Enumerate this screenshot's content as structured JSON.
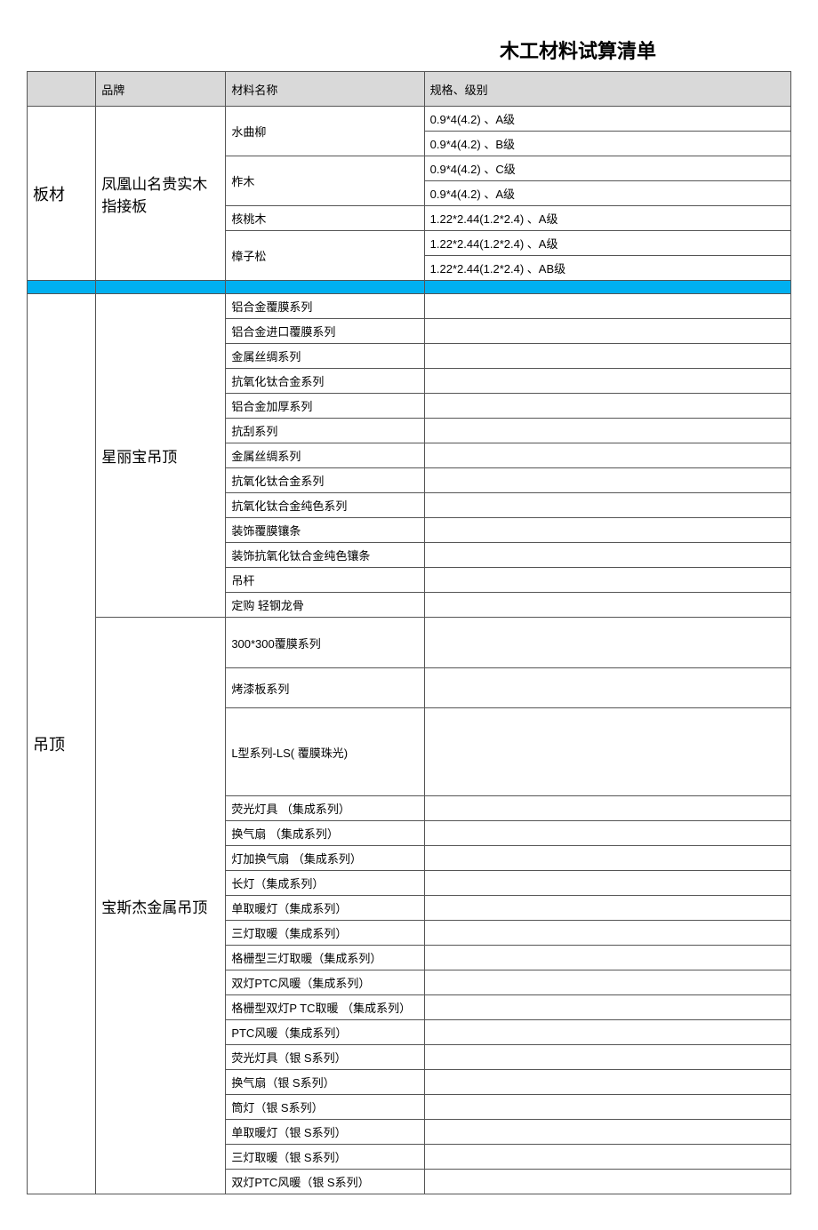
{
  "title": "木工材料试算清单",
  "headers": {
    "col1": "",
    "col2": "品牌",
    "col3": "材料名称",
    "col4": "规格、级别"
  },
  "section1": {
    "category": "板材",
    "brand": "凤凰山名贵实木指接板",
    "rows": [
      {
        "material": "水曲柳",
        "spec": "0.9*4(4.2)  、A级"
      },
      {
        "material": "",
        "spec": "0.9*4(4.2)  、B级"
      },
      {
        "material": "柞木",
        "spec": "0.9*4(4.2)  、C级"
      },
      {
        "material": "",
        "spec": "0.9*4(4.2)  、A级"
      },
      {
        "material": "核桃木",
        "spec": "1.22*2.44(1.2*2.4)   、A级"
      },
      {
        "material": "",
        "spec": "1.22*2.44(1.2*2.4)   、A级"
      },
      {
        "material": "樟子松",
        "spec": "1.22*2.44(1.2*2.4)   、AB级"
      }
    ]
  },
  "section2": {
    "category": "吊顶",
    "brand1": "星丽宝吊顶",
    "brand2": "宝斯杰金属吊顶",
    "rows1": [
      "铝合金覆膜系列",
      "铝合金进口覆膜系列",
      "金属丝绸系列",
      "抗氧化钛合金系列",
      "铝合金加厚系列",
      "抗刮系列",
      "金属丝绸系列",
      "抗氧化钛合金系列",
      "抗氧化钛合金纯色系列",
      "装饰覆膜镶条",
      "装饰抗氧化钛合金纯色镶条",
      "吊杆",
      "定购 轻钢龙骨"
    ],
    "rows2": [
      "300*300覆膜系列",
      "烤漆板系列",
      "L型系列-LS( 覆膜珠光)",
      "荧光灯具 （集成系列）",
      "换气扇 （集成系列）",
      "灯加换气扇 （集成系列）",
      "长灯（集成系列）",
      "单取暖灯（集成系列）",
      "三灯取暖（集成系列）",
      "格栅型三灯取暖（集成系列）",
      "双灯PTC风暖（集成系列）",
      "格栅型双灯P TC取暖 （集成系列）",
      "PTC风暖（集成系列）",
      "荧光灯具（银 S系列）",
      "换气扇（银 S系列）",
      "筒灯（银 S系列）",
      "单取暖灯（银 S系列）",
      "三灯取暖（银 S系列）",
      "双灯PTC风暖（银 S系列）"
    ]
  }
}
